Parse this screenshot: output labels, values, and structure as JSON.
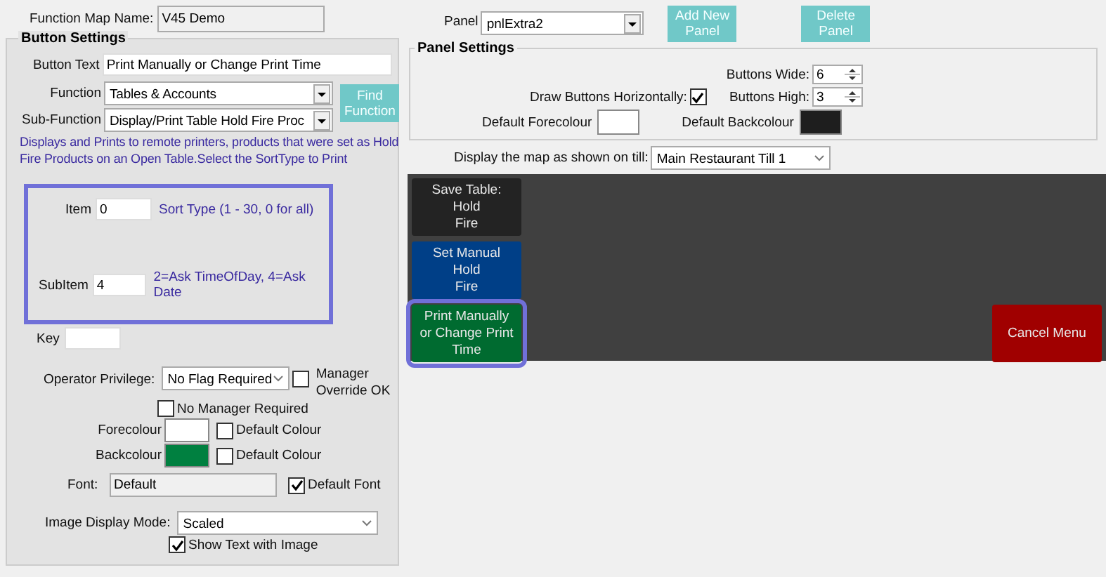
{
  "function_map": {
    "label": "Function Map Name:",
    "value": "V45 Demo"
  },
  "button_settings": {
    "title": "Button Settings",
    "button_text": {
      "label": "Button Text",
      "value": "Print Manually or Change Print Time"
    },
    "function": {
      "label": "Function",
      "value": "Tables & Accounts"
    },
    "sub_function": {
      "label": "Sub-Function",
      "value": "Display/Print Table Hold Fire Proc"
    },
    "find_button": "Find Function",
    "description": "Displays and Prints to remote printers, products that were set as Hold Fire Products on an Open Table.Select the SortType to Print",
    "params": [
      {
        "label": "Item",
        "value": "0",
        "hint": "Sort Type (1 - 30, 0 for all)"
      },
      {
        "label": "SubItem",
        "value": "4",
        "hint": "2=Ask TimeOfDay, 4=Ask Date"
      }
    ],
    "key": {
      "label": "Key"
    },
    "operator_privilege": {
      "label": "Operator Privilege:",
      "value": "No Flag Required"
    },
    "manager_override": {
      "label": "Manager Override OK",
      "checked": false
    },
    "no_manager": {
      "label": "No Manager Required",
      "checked": false
    },
    "colours": [
      {
        "label": "Forecolour",
        "color": "#ffffff",
        "default_label": "Default Colour",
        "checked": false
      },
      {
        "label": "Backcolour",
        "color": "#008040",
        "default_label": "Default Colour",
        "checked": false
      }
    ],
    "font": {
      "label": "Font:",
      "value": "Default",
      "default_label": "Default Font",
      "checked": true
    },
    "image_mode": {
      "label": "Image Display Mode:",
      "value": "Scaled"
    },
    "show_text": {
      "label": "Show Text with Image",
      "checked": true
    }
  },
  "panel": {
    "label": "Panel",
    "value": "pnlExtra2"
  },
  "add_panel_button": "Add New Panel",
  "delete_panel_button": "Delete Panel",
  "panel_settings": {
    "title": "Panel Settings",
    "buttons_wide": {
      "label": "Buttons Wide:",
      "value": "6"
    },
    "buttons_high": {
      "label": "Buttons High:",
      "value": "3"
    },
    "draw_horizontally": {
      "label": "Draw Buttons Horizontally:",
      "checked": true
    },
    "default_forecolour": {
      "label": "Default Forecolour",
      "color": "#ffffff"
    },
    "default_backcolour": {
      "label": "Default Backcolour",
      "color": "#1e1e1e"
    }
  },
  "display_till": {
    "label": "Display the map as shown on till:",
    "value": "Main Restaurant Till 1"
  },
  "map_buttons": [
    {
      "kind": "function",
      "lines": [
        "Save Table:",
        "Hold",
        "Fire"
      ],
      "color": "#232323",
      "selected": false
    },
    {
      "kind": "function",
      "lines": [
        "Set Manual",
        "Hold",
        "Fire"
      ],
      "color": "#003f87",
      "selected": false
    },
    {
      "kind": "function",
      "lines": [
        "Print Manually",
        "or Change Print",
        "Time"
      ],
      "color": "#006b30",
      "selected": true
    },
    {
      "kind": "cancel",
      "lines": [
        "Cancel Menu"
      ],
      "color": "#a00000",
      "selected": false
    }
  ]
}
